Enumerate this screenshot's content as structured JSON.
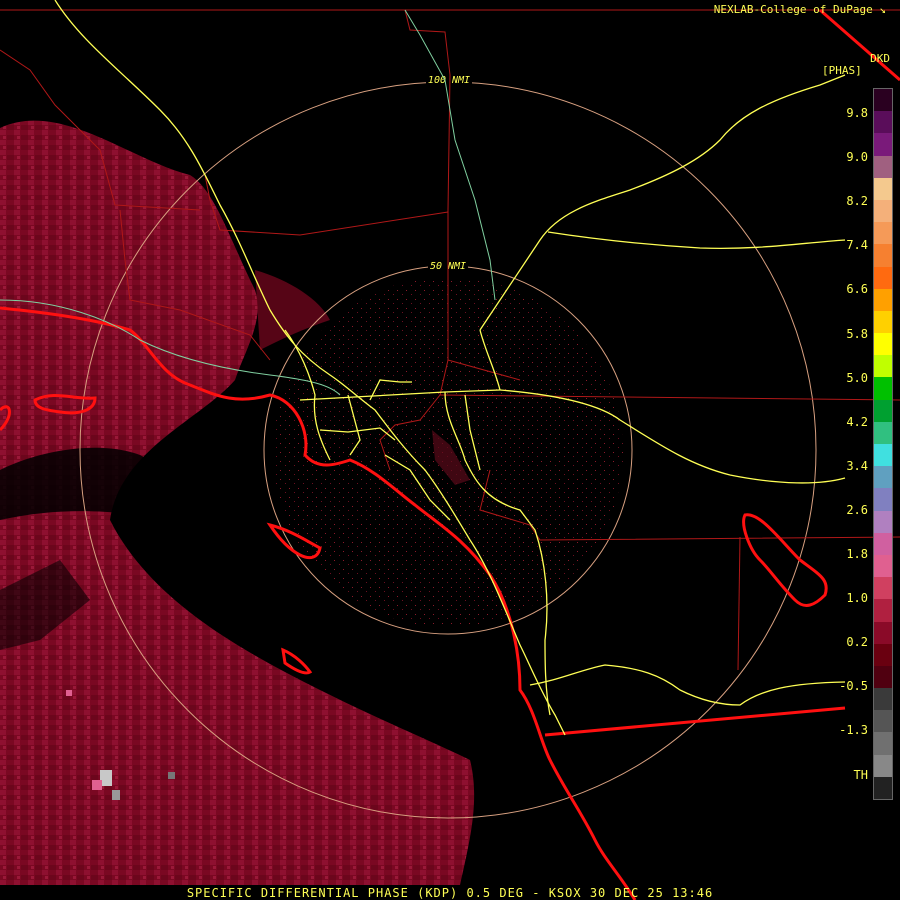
{
  "header": {
    "credit": "NEXLAB-College of DuPage",
    "logo_glyph": "↘"
  },
  "legend": {
    "title_top": "DKD",
    "title_bottom": "[PHAS]",
    "ticks": [
      "9.8",
      "9.0",
      "8.2",
      "7.4",
      "6.6",
      "5.8",
      "5.0",
      "4.2",
      "3.4",
      "2.6",
      "1.8",
      "1.0",
      "0.2",
      "-0.5",
      "-1.3",
      "TH"
    ],
    "colors": [
      "#2a0020",
      "#5a0d5a",
      "#7a1a7a",
      "#a06080",
      "#f4c98e",
      "#f4b07a",
      "#f59a58",
      "#f68030",
      "#ff6a10",
      "#ffa000",
      "#ffd000",
      "#ffff00",
      "#c0ff00",
      "#00c000",
      "#00a030",
      "#30c080",
      "#40e0e0",
      "#60a0c0",
      "#8080c0",
      "#b080c0",
      "#d060a0",
      "#e06090",
      "#d04060",
      "#b02040",
      "#8a0a28",
      "#6a0010",
      "#500010",
      "#3a3a3a",
      "#555555",
      "#707070",
      "#888888",
      "#222222"
    ]
  },
  "map": {
    "ring_labels": {
      "inner": "50 NMI",
      "outer": "100 NMI"
    },
    "colors": {
      "rings": "#d8a080",
      "roads": "#ffff55",
      "county": "#b01818",
      "coast": "#ff1010",
      "river": "#80d0a0",
      "echo": "#8a0a28"
    }
  },
  "footer": {
    "caption": "SPECIFIC DIFFERENTIAL PHASE (KDP) 0.5 DEG - KSOX 30 DEC 25 13:46"
  }
}
